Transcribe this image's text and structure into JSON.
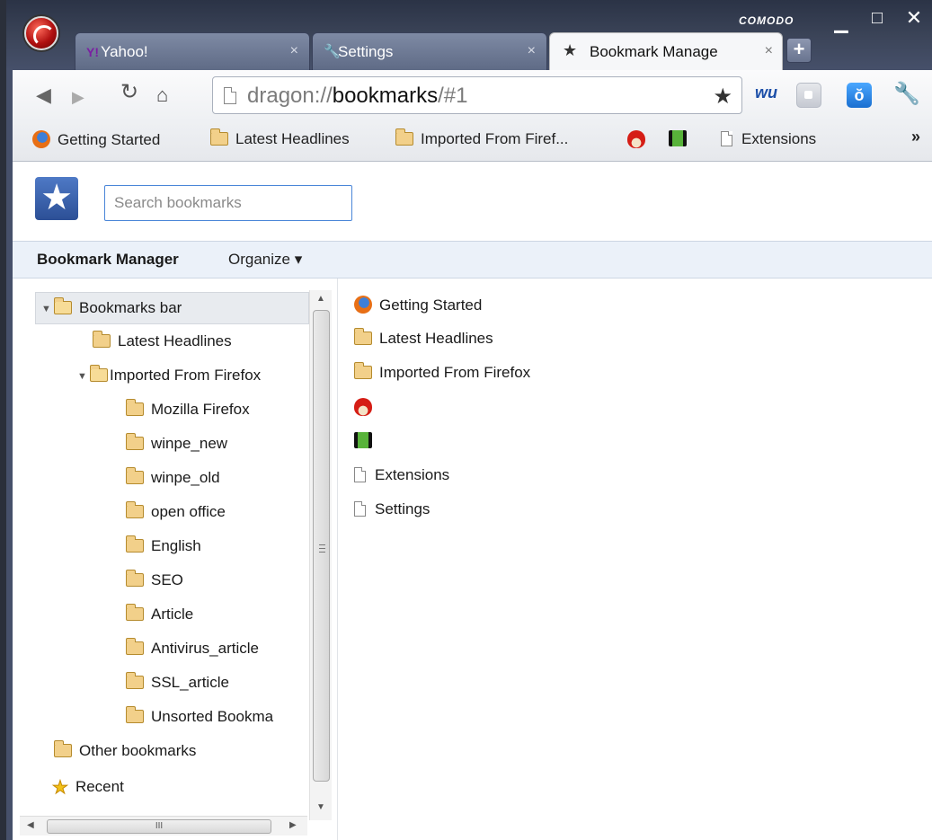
{
  "window": {
    "brand": "COMODO",
    "minimize": "▁",
    "maximize": "□",
    "close": "✕"
  },
  "tabs": [
    {
      "label": "Yahoo!",
      "icon": "yahoo-icon",
      "close": "×"
    },
    {
      "label": "Settings",
      "icon": "wrench-icon",
      "close": "×"
    },
    {
      "label": "Bookmark Manage",
      "icon": "star-icon",
      "close": "×",
      "active": true
    }
  ],
  "new_tab": "+",
  "toolbar": {
    "url_scheme": "dragon://",
    "url_host": "bookmarks",
    "url_path": "/#1"
  },
  "bookmarks_bar": {
    "items": [
      {
        "label": "Getting Started",
        "icon": "firefox-icon"
      },
      {
        "label": "Latest Headlines",
        "icon": "folder-icon"
      },
      {
        "label": "Imported From Firef...",
        "icon": "folder-icon"
      },
      {
        "label": "",
        "icon": "angry-bird-icon"
      },
      {
        "label": "",
        "icon": "film-icon"
      },
      {
        "label": "Extensions",
        "icon": "page-icon"
      }
    ],
    "overflow": "»"
  },
  "manager": {
    "search_placeholder": "Search bookmarks",
    "title": "Bookmark Manager",
    "organize": "Organize ▾"
  },
  "tree": [
    {
      "label": "Bookmarks bar",
      "level": 0,
      "expanded": true,
      "selected": true
    },
    {
      "label": "Latest Headlines",
      "level": 1
    },
    {
      "label": "Imported From Firefox",
      "level": 1,
      "expanded": true
    },
    {
      "label": "Mozilla Firefox",
      "level": 2
    },
    {
      "label": "winpe_new",
      "level": 2
    },
    {
      "label": "winpe_old",
      "level": 2
    },
    {
      "label": "open office",
      "level": 2
    },
    {
      "label": "English",
      "level": 2
    },
    {
      "label": "SEO",
      "level": 2
    },
    {
      "label": "Article",
      "level": 2
    },
    {
      "label": "Antivirus_article",
      "level": 2
    },
    {
      "label": "SSL_article",
      "level": 2
    },
    {
      "label": "Unsorted Bookma",
      "level": 2
    },
    {
      "label": "Other bookmarks",
      "level": 0
    },
    {
      "label": "Recent",
      "level": 0,
      "icon": "star-icon"
    }
  ],
  "list": [
    {
      "label": "Getting Started",
      "icon": "firefox-icon"
    },
    {
      "label": "Latest Headlines",
      "icon": "folder-icon"
    },
    {
      "label": "Imported From Firefox",
      "icon": "folder-icon"
    },
    {
      "label": "",
      "icon": "angry-bird-icon"
    },
    {
      "label": "",
      "icon": "film-icon"
    },
    {
      "label": "Extensions",
      "icon": "page-icon"
    },
    {
      "label": "Settings",
      "icon": "page-icon"
    }
  ],
  "scrollbar": {
    "grip": "≡",
    "h_grip": "III"
  }
}
